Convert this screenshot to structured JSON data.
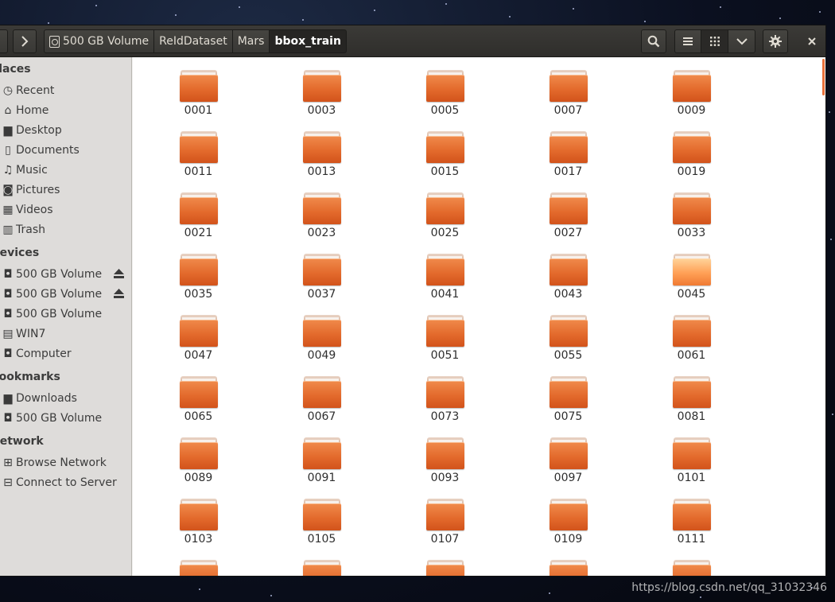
{
  "pathbar": {
    "crumbs": [
      {
        "label": "500 GB Volume"
      },
      {
        "label": "ReIdDataset"
      },
      {
        "label": "Mars"
      },
      {
        "label": "bbox_train"
      }
    ]
  },
  "sidebar": {
    "places_heading": "Places",
    "places": [
      {
        "label": "Recent",
        "icon": "recent-icon"
      },
      {
        "label": "Home",
        "icon": "home-icon"
      },
      {
        "label": "Desktop",
        "icon": "folder-icon"
      },
      {
        "label": "Documents",
        "icon": "document-icon"
      },
      {
        "label": "Music",
        "icon": "music-icon"
      },
      {
        "label": "Pictures",
        "icon": "camera-icon"
      },
      {
        "label": "Videos",
        "icon": "film-icon"
      },
      {
        "label": "Trash",
        "icon": "trash-icon"
      }
    ],
    "devices_heading": "Devices",
    "devices": [
      {
        "label": "500 GB Volume",
        "icon": "drive-icon",
        "eject": true
      },
      {
        "label": "500 GB Volume",
        "icon": "drive-icon",
        "eject": true
      },
      {
        "label": "500 GB Volume",
        "icon": "drive-icon",
        "eject": false
      },
      {
        "label": "WIN7",
        "icon": "harddisk-icon",
        "eject": false
      },
      {
        "label": "Computer",
        "icon": "drive-icon",
        "eject": false
      }
    ],
    "bookmarks_heading": "Bookmarks",
    "bookmarks": [
      {
        "label": "Downloads",
        "icon": "folder-icon"
      },
      {
        "label": "500 GB Volume",
        "icon": "drive-icon"
      }
    ],
    "network_heading": "Network",
    "network": [
      {
        "label": "Browse Network",
        "icon": "network-icon"
      },
      {
        "label": "Connect to Server",
        "icon": "server-icon"
      }
    ]
  },
  "folders": [
    "0001",
    "0003",
    "0005",
    "0007",
    "0009",
    "0011",
    "0013",
    "0015",
    "0017",
    "0019",
    "0021",
    "0023",
    "0025",
    "0027",
    "0033",
    "0035",
    "0037",
    "0041",
    "0043",
    "0045",
    "0047",
    "0049",
    "0051",
    "0055",
    "0061",
    "0065",
    "0067",
    "0073",
    "0075",
    "0081",
    "0089",
    "0091",
    "0093",
    "0097",
    "0101",
    "0103",
    "0105",
    "0107",
    "0109",
    "0111",
    "",
    "",
    "",
    "",
    ""
  ],
  "highlighted_folder": "0045",
  "colors": {
    "accent": "#e36a2c",
    "headerbar": "#3b3a37",
    "sidebar": "#dedcda"
  },
  "watermark": "https://blog.csdn.net/qq_31032346"
}
